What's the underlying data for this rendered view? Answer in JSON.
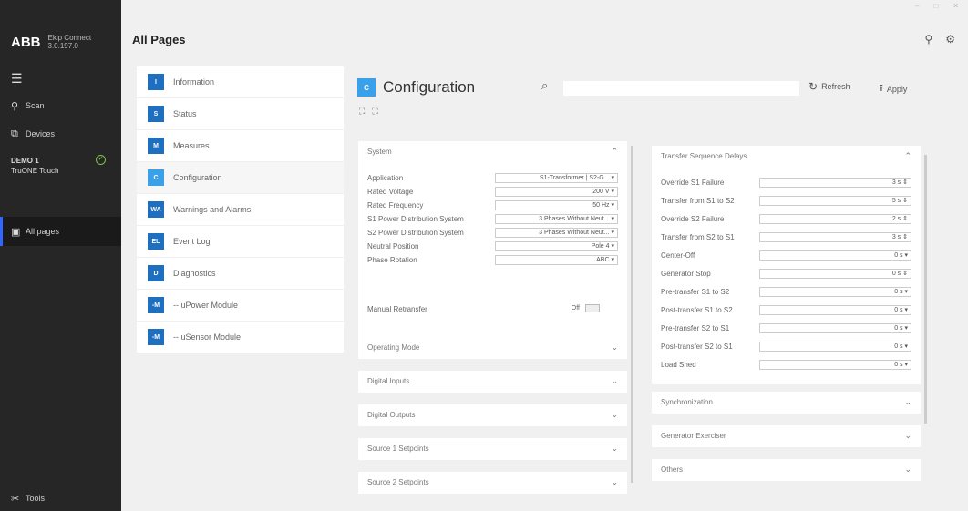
{
  "window": {
    "minimize": "–",
    "maximize": "□",
    "close": "✕"
  },
  "brand": {
    "logo": "ABB",
    "line1": "Ekip Connect",
    "line2": "3.0.197.0"
  },
  "sidebar": {
    "menu_icon": "☰",
    "scan": "Scan",
    "devices": "Devices",
    "device_name": "DEMO 1",
    "device_model": "TruONE Touch",
    "all_pages": "All pages",
    "tools": "Tools"
  },
  "page_title": "All Pages",
  "nav": [
    {
      "badge": "I",
      "label": "Information"
    },
    {
      "badge": "S",
      "label": "Status"
    },
    {
      "badge": "M",
      "label": "Measures"
    },
    {
      "badge": "C",
      "label": "Configuration"
    },
    {
      "badge": "WA",
      "label": "Warnings and Alarms"
    },
    {
      "badge": "EL",
      "label": "Event Log"
    },
    {
      "badge": "D",
      "label": "Diagnostics"
    },
    {
      "badge": "-M",
      "label": "-- uPower Module"
    },
    {
      "badge": "-M",
      "label": "-- uSensor Module"
    }
  ],
  "content": {
    "badge": "C",
    "title": "Configuration",
    "search_placeholder": "",
    "refresh": "Refresh",
    "apply": "Apply",
    "expand_all": "⛶",
    "collapse_all": "⛶"
  },
  "system": {
    "title": "System",
    "rows": [
      {
        "label": "Application",
        "value": "S1-Transformer | S2-G... ▾"
      },
      {
        "label": "Rated Voltage",
        "value": "200 V ▾"
      },
      {
        "label": "Rated Frequency",
        "value": "50 Hz ▾"
      },
      {
        "label": "S1 Power Distribution System",
        "value": "3 Phases Without Neut... ▾"
      },
      {
        "label": "S2 Power Distribution System",
        "value": "3 Phases Without Neut... ▾"
      },
      {
        "label": "Neutral Position",
        "value": "Pole 4 ▾"
      },
      {
        "label": "Phase Rotation",
        "value": "ABC ▾"
      }
    ],
    "manual_label": "Manual Retransfer",
    "manual_value": "Off"
  },
  "left_sections": [
    "Operating Mode",
    "Digital Inputs",
    "Digital Outputs",
    "Source 1 Setpoints",
    "Source 2 Setpoints"
  ],
  "delays": {
    "title": "Transfer Sequence Delays",
    "rows": [
      {
        "label": "Override S1 Failure",
        "value": "3 s ⇕"
      },
      {
        "label": "Transfer from S1 to S2",
        "value": "5 s ⇕"
      },
      {
        "label": "Override S2 Failure",
        "value": "2 s ⇕"
      },
      {
        "label": "Transfer from S2 to S1",
        "value": "3 s ⇕"
      },
      {
        "label": "Center-Off",
        "value": "0 s ▾"
      },
      {
        "label": "Generator Stop",
        "value": "0 s ⇕"
      },
      {
        "label": "Pre-transfer S1 to S2",
        "value": "0 s ▾"
      },
      {
        "label": "Post-transfer S1 to S2",
        "value": "0 s ▾"
      },
      {
        "label": "Pre-transfer S2 to S1",
        "value": "0 s ▾"
      },
      {
        "label": "Post-transfer S2 to S1",
        "value": "0 s ▾"
      },
      {
        "label": "Load Shed",
        "value": "0 s ▾"
      }
    ]
  },
  "right_sections": [
    "Synchronization",
    "Generator Exerciser",
    "Others"
  ],
  "icons": {
    "chevron_down": "⌄",
    "chevron_up": "⌃",
    "search": "⌕",
    "refresh": "↻",
    "apply": "⭱",
    "bulb": "⚲",
    "gear": "⚙"
  }
}
